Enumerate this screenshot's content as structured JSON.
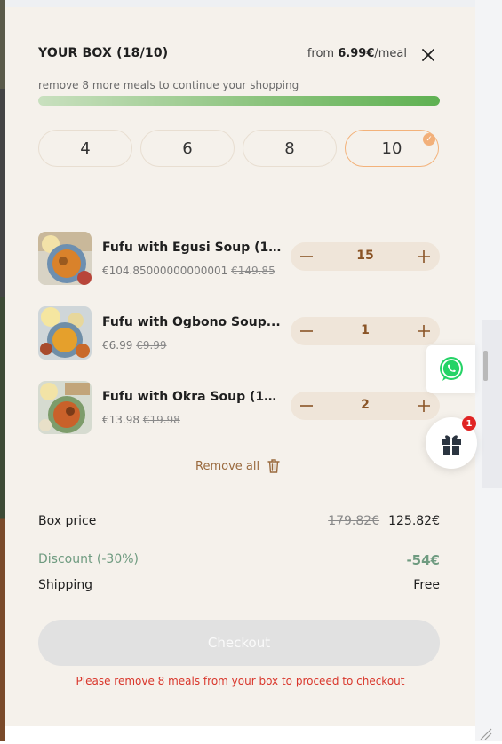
{
  "header": {
    "title": "YOUR BOX (18/10)",
    "price_prefix": "from",
    "price_value": "6.99€",
    "price_suffix": "/meal",
    "close_icon": "close-icon"
  },
  "hint": "remove 8 more meals to continue your shopping",
  "progress": {
    "percent": 100,
    "color_start": "#c9e0bf",
    "color_end": "#5fb152"
  },
  "box_sizes": {
    "options": [
      "4",
      "6",
      "8",
      "10"
    ],
    "selected": "10"
  },
  "items": [
    {
      "name": "Fufu with Egusi Soup (10...",
      "price": "€104.85000000000001",
      "old_price": "€149.85",
      "quantity": "15"
    },
    {
      "name": "Fufu with Ogbono Soup...",
      "price": "€6.99",
      "old_price": "€9.99",
      "quantity": "1"
    },
    {
      "name": "Fufu with Okra Soup (10...",
      "price": "€13.98",
      "old_price": "€19.98",
      "quantity": "2"
    }
  ],
  "remove_all": "Remove all",
  "summary": {
    "box_price_label": "Box price",
    "box_price_old": "179.82€",
    "box_price_new": "125.82€",
    "discount_label": "Discount (-30%)",
    "discount_value": "-54€",
    "shipping_label": "Shipping",
    "shipping_value": "Free"
  },
  "checkout": {
    "label": "Checkout",
    "error": "Please remove 8 meals from your box to proceed to checkout"
  },
  "gift_badge": "1",
  "colors": {
    "panel_bg": "#f5f1eb",
    "accent_orange": "#f3b27a",
    "stepper_text": "#8a5426",
    "discount_green": "#6f9b80",
    "error_red": "#d9362b"
  }
}
